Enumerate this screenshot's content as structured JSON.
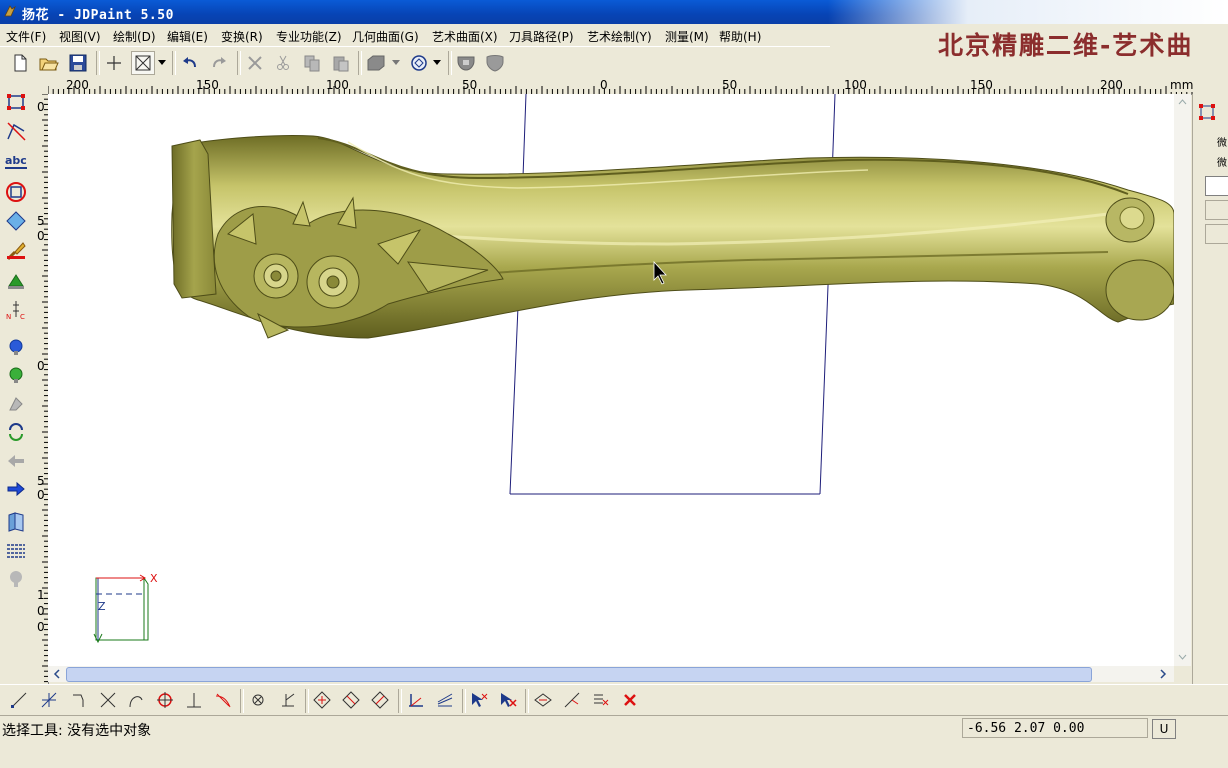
{
  "window": {
    "title": "扬花  - JDPaint 5.50"
  },
  "menu": [
    "文件(F)",
    "视图(V)",
    "绘制(D)",
    "编辑(E)",
    "变换(R)",
    "专业功能(Z)",
    "几何曲面(G)",
    "艺术曲面(X)",
    "刀具路径(P)",
    "艺术绘制(Y)",
    "测量(M)",
    "帮助(H)"
  ],
  "brand": "北京精雕二维-艺术曲",
  "ruler": {
    "labels": [
      "200",
      "150",
      "100",
      "50",
      "0",
      "50",
      "100",
      "150",
      "200"
    ],
    "unit": "mm"
  },
  "vruler": {
    "labels": [
      "0",
      "5",
      "0",
      "0",
      "5",
      "0",
      "1",
      "0",
      "0"
    ]
  },
  "axis": {
    "x": "X",
    "z": "Z"
  },
  "status": {
    "text": "选择工具: 没有选中对象",
    "coords": "-6.56 2.07 0.00",
    "button": "U"
  },
  "rightpanel": {
    "labels": [
      "微",
      "微"
    ]
  },
  "colors": {
    "model": "#9a9b45",
    "frame": "#1e1e7a",
    "brand": "#8b2d2d"
  }
}
